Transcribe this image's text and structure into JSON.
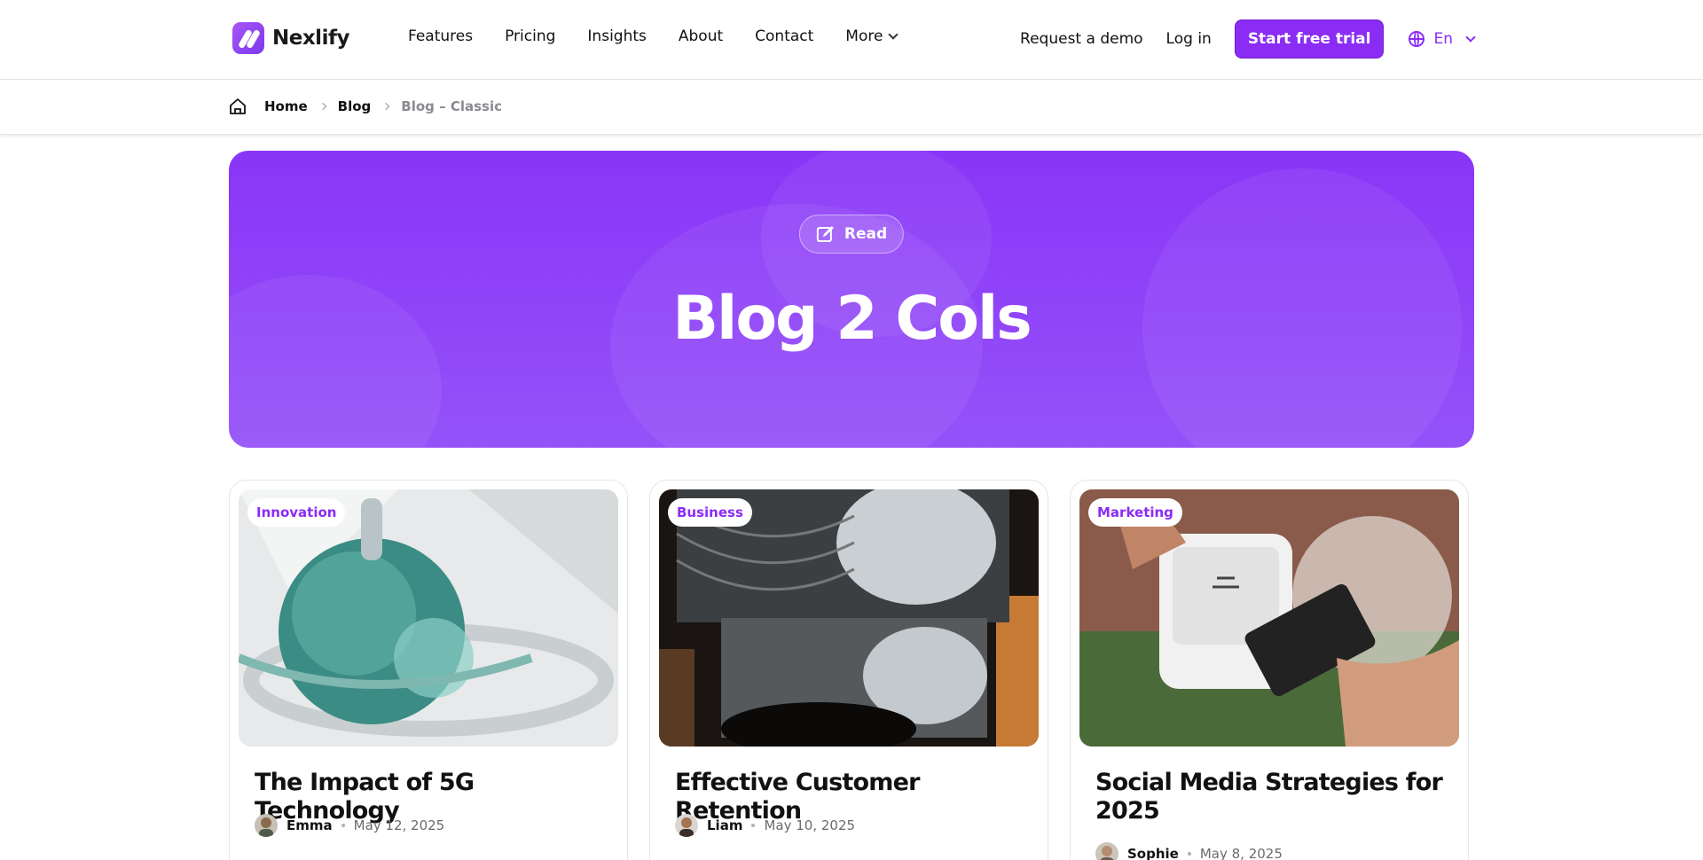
{
  "header": {
    "logo_text": "Nexlify",
    "nav": [
      "Features",
      "Pricing",
      "Insights",
      "About",
      "Contact",
      "More"
    ],
    "request_demo": "Request a demo",
    "login": "Log in",
    "cta": "Start free trial",
    "language": "En",
    "accent": "#8b2cf5"
  },
  "breadcrumb": {
    "items": [
      "Home",
      "Blog",
      "Blog – Classic"
    ]
  },
  "hero": {
    "badge": "Read",
    "title": "Blog 2 Cols",
    "background": "#8a35f7"
  },
  "posts": [
    {
      "category": "Innovation",
      "title": "The Impact of 5G Technology",
      "author": "Emma",
      "date": "May 12, 2025"
    },
    {
      "category": "Business",
      "title": "Effective Customer Retention",
      "author": "Liam",
      "date": "May 10, 2025"
    },
    {
      "category": "Marketing",
      "title": "Social Media Strategies for 2025",
      "author": "Sophie",
      "date": "May 8, 2025"
    }
  ]
}
